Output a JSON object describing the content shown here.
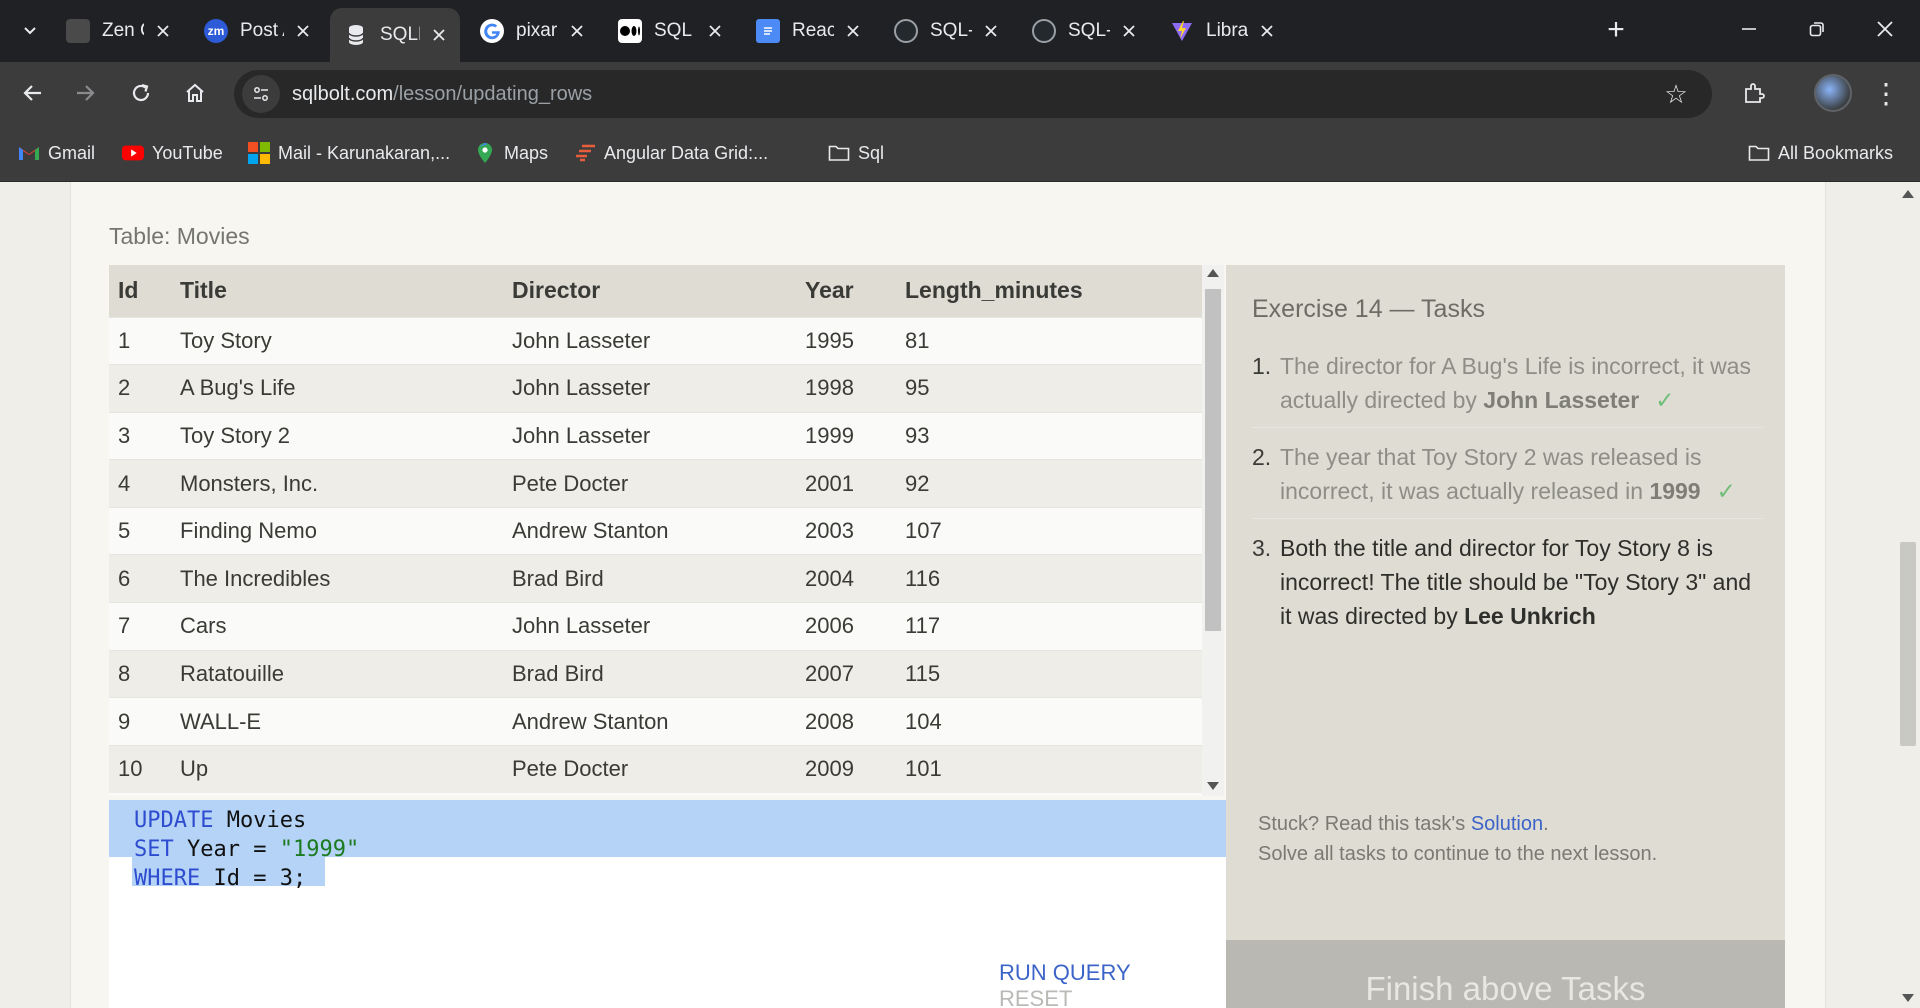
{
  "browser": {
    "tabs": [
      {
        "title": "Zen Clas",
        "favicon": "zen-class-icon",
        "active": false
      },
      {
        "title": "Post Att",
        "favicon": "zoom-icon",
        "favicon_text": "zm",
        "active": false
      },
      {
        "title": "SQLBolt",
        "favicon": "sqlbolt-icon",
        "active": true
      },
      {
        "title": "pixar mo",
        "favicon": "google-icon",
        "active": false
      },
      {
        "title": "SQL BO",
        "favicon": "medium-icon",
        "active": false
      },
      {
        "title": "React A",
        "favicon": "google-docs-icon",
        "active": false
      },
      {
        "title": "SQL-BO",
        "favicon": "github-icon",
        "active": false
      },
      {
        "title": "SQL-BO",
        "favicon": "github-icon",
        "active": false
      },
      {
        "title": "Library",
        "favicon": "vite-icon",
        "active": false
      }
    ],
    "url_host": "sqlbolt.com",
    "url_path": "/lesson/updating_rows",
    "bookmarks": [
      {
        "label": "Gmail",
        "icon": "gmail-icon"
      },
      {
        "label": "YouTube",
        "icon": "youtube-icon"
      },
      {
        "label": "Mail - Karunakaran,...",
        "icon": "microsoft-icon"
      },
      {
        "label": "Maps",
        "icon": "maps-pin-icon"
      },
      {
        "label": "Angular Data Grid:...",
        "icon": "ag-grid-icon"
      },
      {
        "label": "Sql",
        "icon": "folder-icon"
      }
    ],
    "all_bookmarks": "All Bookmarks"
  },
  "lesson": {
    "table_caption": "Table: Movies",
    "columns": [
      "Id",
      "Title",
      "Director",
      "Year",
      "Length_minutes"
    ],
    "rows": [
      [
        "1",
        "Toy Story",
        "John Lasseter",
        "1995",
        "81"
      ],
      [
        "2",
        "A Bug's Life",
        "John Lasseter",
        "1998",
        "95"
      ],
      [
        "3",
        "Toy Story 2",
        "John Lasseter",
        "1999",
        "93"
      ],
      [
        "4",
        "Monsters, Inc.",
        "Pete Docter",
        "2001",
        "92"
      ],
      [
        "5",
        "Finding Nemo",
        "Andrew Stanton",
        "2003",
        "107"
      ],
      [
        "6",
        "The Incredibles",
        "Brad Bird",
        "2004",
        "116"
      ],
      [
        "7",
        "Cars",
        "John Lasseter",
        "2006",
        "117"
      ],
      [
        "8",
        "Ratatouille",
        "Brad Bird",
        "2007",
        "115"
      ],
      [
        "9",
        "WALL-E",
        "Andrew Stanton",
        "2008",
        "104"
      ],
      [
        "10",
        "Up",
        "Pete Docter",
        "2009",
        "101"
      ]
    ],
    "query_lines": [
      [
        {
          "t": "UPDATE",
          "k": "kw"
        },
        {
          "t": " Movies",
          "k": ""
        }
      ],
      [
        {
          "t": "SET",
          "k": "kw"
        },
        {
          "t": " Year = ",
          "k": ""
        },
        {
          "t": "\"1999\"",
          "k": "str"
        }
      ],
      [
        {
          "t": "WHERE",
          "k": "kw"
        },
        {
          "t": " Id = 3;",
          "k": ""
        }
      ]
    ],
    "run_label": "RUN QUERY",
    "reset_label": "RESET",
    "tasks_title": "Exercise 14 — Tasks",
    "tasks": [
      {
        "num": "1.",
        "text": "The director for A Bug's Life is incorrect, it was actually directed by ",
        "bold": "John Lasseter",
        "done": true
      },
      {
        "num": "2.",
        "text": "The year that Toy Story 2 was released is incorrect, it was actually released in ",
        "bold": "1999",
        "done": true
      },
      {
        "num": "3.",
        "text": "Both the title and director for Toy Story 8 is incorrect! The title should be \"Toy Story 3\" and it was directed by ",
        "bold": "Lee Unkrich",
        "done": false
      }
    ],
    "check_mark": "✓",
    "stuck_prefix": "Stuck? Read this task's ",
    "solution_link": "Solution",
    "stuck_suffix": ".",
    "continue_text": "Solve all tasks to continue to the next lesson.",
    "finish_label": "Finish above Tasks"
  }
}
